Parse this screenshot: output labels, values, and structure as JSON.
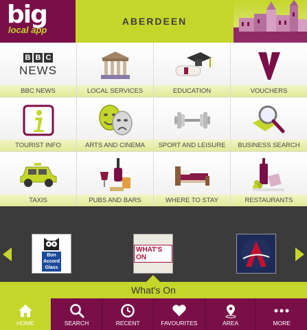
{
  "header": {
    "logo_big": "big",
    "logo_sub": "local app",
    "city": "ABERDEEN"
  },
  "grid": {
    "items": [
      {
        "label": "BBC NEWS",
        "icon": "bbc-news-icon"
      },
      {
        "label": "LOCAL SERVICES",
        "icon": "local-services-icon"
      },
      {
        "label": "EDUCATION",
        "icon": "education-icon"
      },
      {
        "label": "VOUCHERS",
        "icon": "vouchers-icon"
      },
      {
        "label": "TOURIST INFO",
        "icon": "tourist-info-icon"
      },
      {
        "label": "ARTS AND CINEMA",
        "icon": "arts-cinema-icon"
      },
      {
        "label": "SPORT AND LEISURE",
        "icon": "sport-leisure-icon"
      },
      {
        "label": "BUSINESS SEARCH",
        "icon": "business-search-icon"
      },
      {
        "label": "TAXIS",
        "icon": "taxi-icon"
      },
      {
        "label": "PUBS AND BARS",
        "icon": "pubs-bars-icon"
      },
      {
        "label": "WHERE TO STAY",
        "icon": "where-to-stay-icon"
      },
      {
        "label": "RESTAURANTS",
        "icon": "restaurants-icon"
      }
    ],
    "bbc_logo": "BBC",
    "bbc_news": "NEWS"
  },
  "carousel": {
    "left": {
      "line1": "Bon",
      "line2": "Accord",
      "line3": "Glass"
    },
    "center": {
      "label": "WHAT'S ON"
    },
    "right": {
      "letter": "A"
    }
  },
  "selected": {
    "title": "What's On"
  },
  "nav": {
    "items": [
      {
        "label": "HOME",
        "icon": "home-icon",
        "active": true
      },
      {
        "label": "SEARCH",
        "icon": "search-icon"
      },
      {
        "label": "RECENT",
        "icon": "clock-icon"
      },
      {
        "label": "FAVOURITES",
        "icon": "heart-icon"
      },
      {
        "label": "AREA",
        "icon": "location-pin-icon"
      },
      {
        "label": "MORE",
        "icon": "more-dots-icon"
      }
    ]
  },
  "colors": {
    "brand": "#7a0f48",
    "accent": "#c5d62a"
  }
}
